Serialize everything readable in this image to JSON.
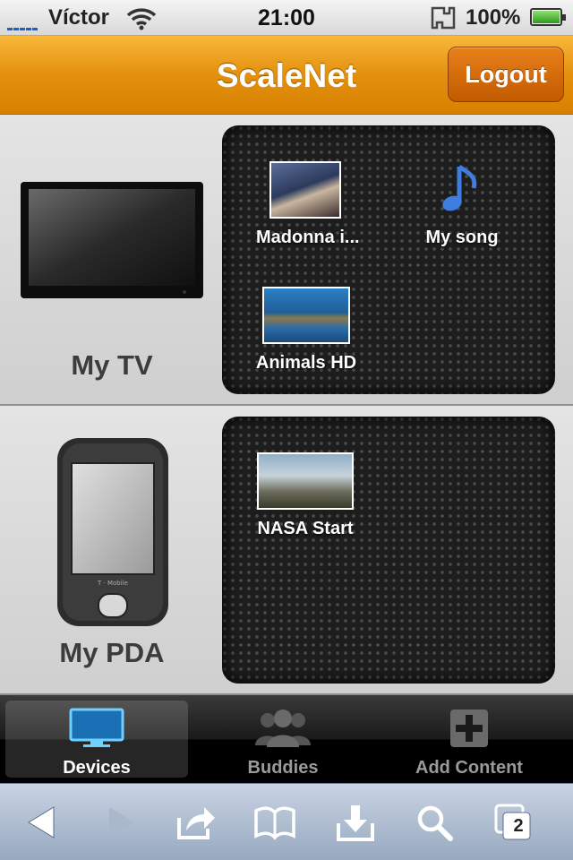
{
  "status": {
    "carrier": "Víctor",
    "time": "21:00",
    "battery": "100%"
  },
  "header": {
    "title": "ScaleNet",
    "logout_label": "Logout"
  },
  "devices": [
    {
      "name": "My TV",
      "items": [
        {
          "label": "Madonna i...",
          "icon": "video-thumbnail"
        },
        {
          "label": "My song",
          "icon": "music-note-icon"
        },
        {
          "label": "Animals HD",
          "icon": "video-thumbnail"
        }
      ]
    },
    {
      "name": "My PDA",
      "items": [
        {
          "label": "NASA Start",
          "icon": "video-thumbnail"
        }
      ]
    }
  ],
  "tabs": [
    {
      "label": "Devices",
      "icon": "monitor-icon",
      "active": true
    },
    {
      "label": "Buddies",
      "icon": "people-icon",
      "active": false
    },
    {
      "label": "Add Content",
      "icon": "plus-icon",
      "active": false
    }
  ],
  "toolbar": {
    "buttons": [
      "back-icon",
      "forward-icon",
      "share-icon",
      "bookmarks-icon",
      "download-icon",
      "search-icon",
      "pages-icon"
    ],
    "pages_count": "2"
  },
  "colors": {
    "header": "#e3900e",
    "logout": "#c25a00",
    "panel": "#1d1d1d"
  }
}
